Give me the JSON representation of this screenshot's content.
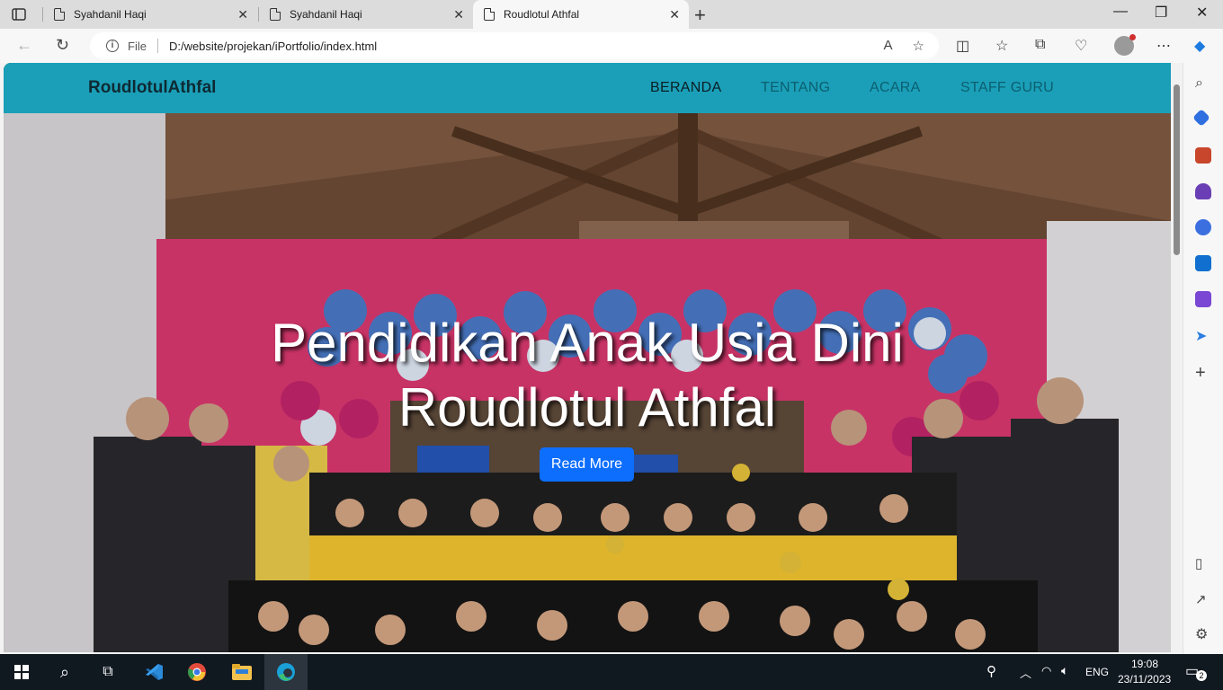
{
  "browser": {
    "tabs": [
      {
        "title": "Syahdanil Haqi",
        "active": false
      },
      {
        "title": "Syahdanil Haqi",
        "active": false
      },
      {
        "title": "Roudlotul Athfal",
        "active": true
      }
    ],
    "address": {
      "scheme_label": "File",
      "url": "D:/website/projekan/iPortfolio/index.html"
    }
  },
  "site": {
    "brand": "RoudlotulAthfal",
    "menu": [
      {
        "label": "BERANDA",
        "active": true
      },
      {
        "label": "TENTANG",
        "active": false
      },
      {
        "label": "ACARA",
        "active": false
      },
      {
        "label": "STAFF GURU",
        "active": false
      }
    ],
    "hero": {
      "title_line1": "Pendidikan Anak Usia Dini",
      "title_line2": "Roudlotul Athfal",
      "button": "Read More"
    }
  },
  "taskbar": {
    "language": "ENG",
    "time": "19:08",
    "date": "23/11/2023",
    "notifications": "2"
  },
  "colors": {
    "nav_bg": "#1b9fb8",
    "button_primary": "#0d6efd",
    "taskbar_bg": "#101820"
  }
}
